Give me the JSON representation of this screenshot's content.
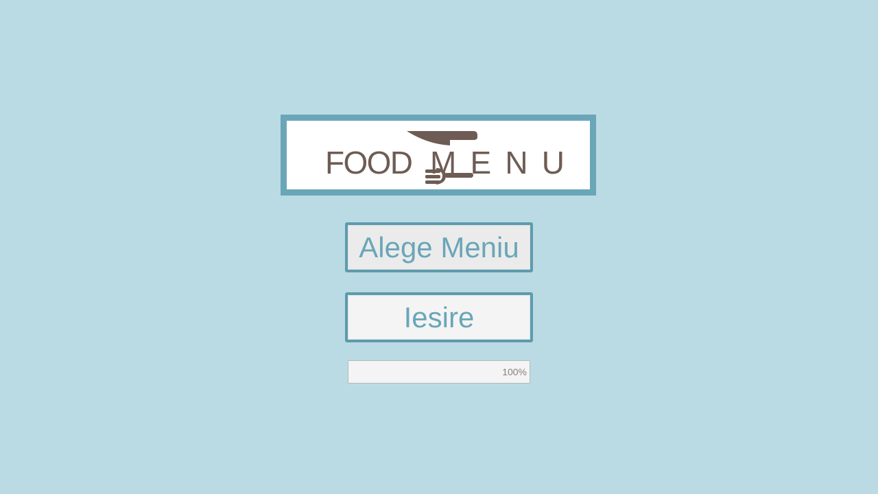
{
  "logo": {
    "text_left": "FOOD",
    "text_right": "MENU",
    "icon": "knife-fork-icon",
    "brand_color": "#6e5c54",
    "frame_color": "#6aa6b8"
  },
  "buttons": {
    "choose_menu_label": "Alege Meniu",
    "exit_label": "Iesire"
  },
  "progress": {
    "value_percent": 100,
    "label": "100%"
  },
  "colors": {
    "background": "#badbe4",
    "accent": "#6aa6b8",
    "button_border": "#5f9aad"
  }
}
